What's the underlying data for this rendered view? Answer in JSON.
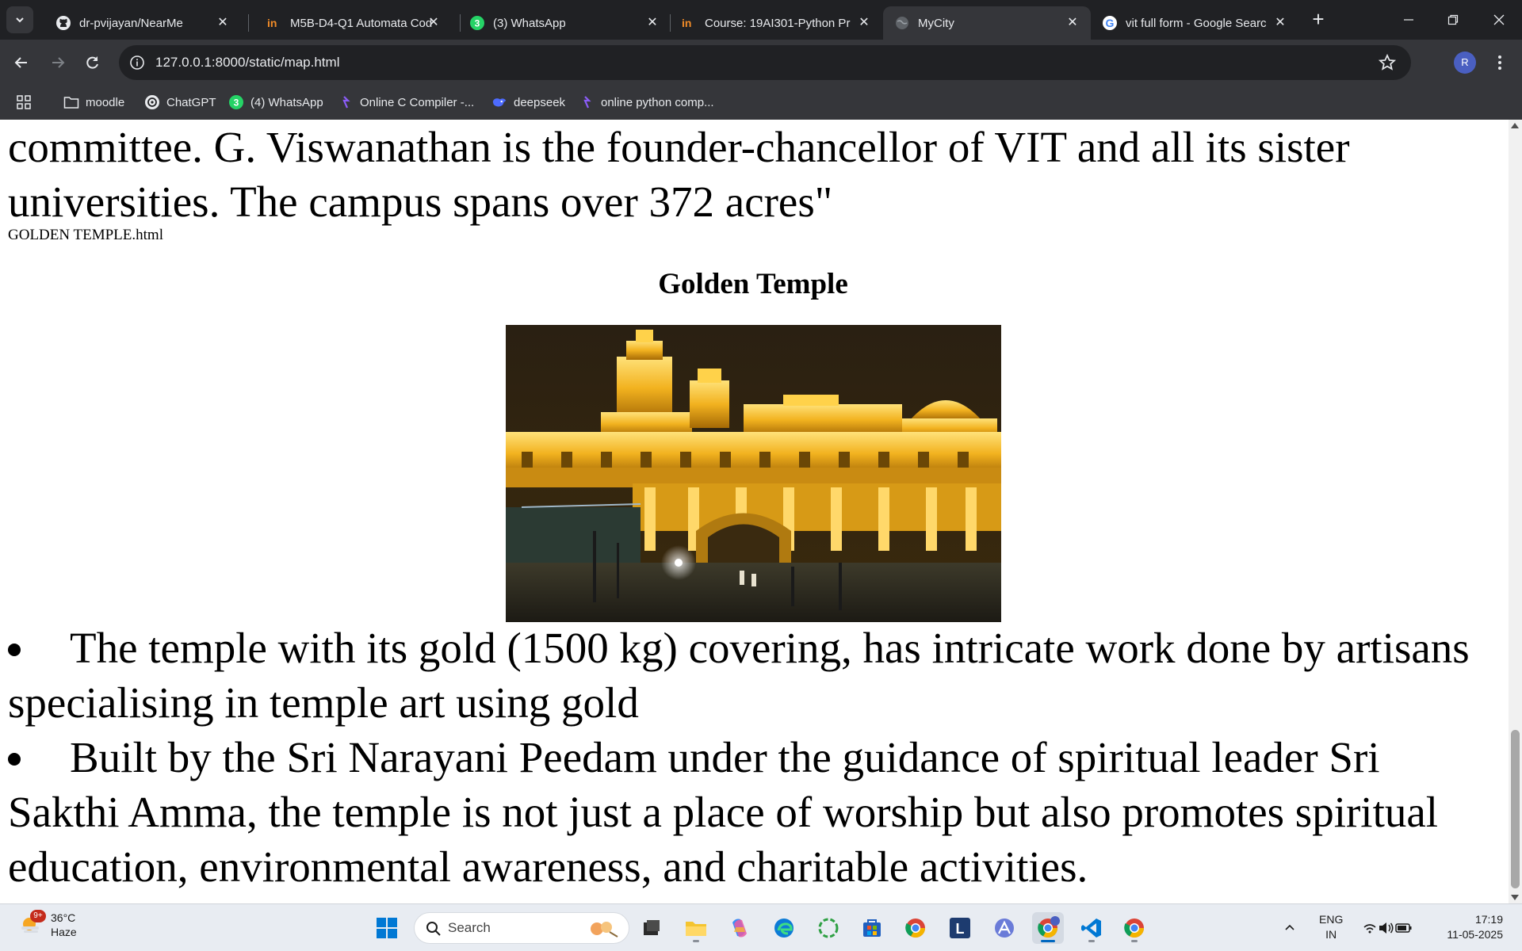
{
  "tabs": [
    {
      "title": "dr-pvijayan/NearMe",
      "icon": "github-icon"
    },
    {
      "title": "M5B-D4-Q1 Automata Cod",
      "icon": "codetantra-icon"
    },
    {
      "title": "(3) WhatsApp",
      "icon": "whatsapp-icon"
    },
    {
      "title": "Course: 19AI301-Python Pr",
      "icon": "codetantra-icon"
    },
    {
      "title": "MyCity",
      "icon": "globe-icon",
      "active": true
    },
    {
      "title": "vit full form - Google Searc",
      "icon": "google-icon"
    }
  ],
  "address_bar": {
    "url": "127.0.0.1:8000/static/map.html"
  },
  "profile": {
    "initial": "R"
  },
  "bookmarks": [
    {
      "label": "moodle",
      "icon": "folder-icon"
    },
    {
      "label": "ChatGPT",
      "icon": "chatgpt-icon"
    },
    {
      "label": "(4) WhatsApp",
      "icon": "whatsapp-icon"
    },
    {
      "label": "Online C Compiler -...",
      "icon": "compiler-icon"
    },
    {
      "label": "deepseek",
      "icon": "deepseek-icon"
    },
    {
      "label": "online python comp...",
      "icon": "compiler-icon"
    }
  ],
  "page": {
    "intro_text": "committee. G. Viswanathan is the founder-chancellor of VIT and all its sister universities. The campus spans over 372 acres\"",
    "file_label": "GOLDEN TEMPLE.html",
    "heading": "Golden Temple",
    "bullets": [
      "The temple with its gold (1500 kg) covering, has intricate work done by artisans specialising in temple art using gold",
      "Built by the Sri Narayani Peedam under the guidance of spiritual leader Sri Sakthi Amma, the temple is not just a place of worship but also promotes spiritual education, environmental awareness, and charitable activities."
    ]
  },
  "taskbar": {
    "weather": {
      "temp": "36°C",
      "condition": "Haze",
      "badge": "9+"
    },
    "search_label": "Search",
    "language": {
      "line1": "ENG",
      "line2": "IN"
    },
    "clock": {
      "time": "17:19",
      "date": "11-05-2025"
    }
  },
  "colors": {
    "tabstrip": "#202124",
    "toolbar": "#35363a",
    "taskbar": "#e8ecf2",
    "accent": "#0067c0"
  }
}
